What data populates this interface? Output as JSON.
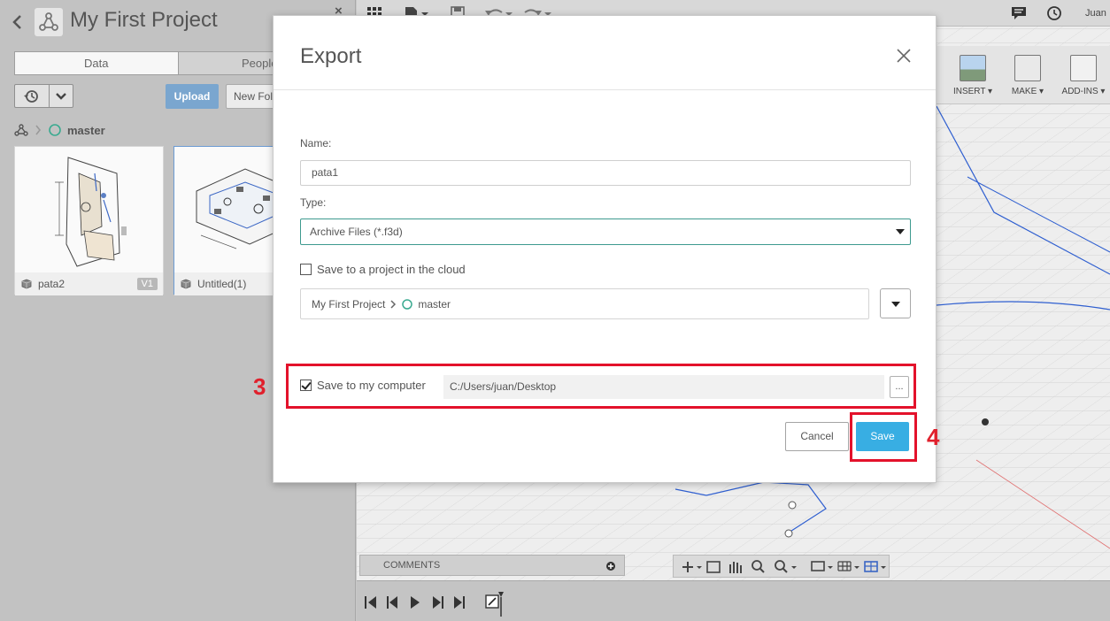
{
  "left_panel": {
    "project_title": "My First Project",
    "close_glyph": "×",
    "tabs": [
      {
        "label": "Data",
        "active": true
      },
      {
        "label": "People",
        "active": false
      }
    ],
    "upload_label": "Upload",
    "new_folder_label": "New Folder",
    "breadcrumb_branch": "master",
    "files": [
      {
        "name": "pata2",
        "version": "V1"
      },
      {
        "name": "Untitled(1)"
      }
    ]
  },
  "ribbon": {
    "items": [
      {
        "label": "INSERT ▾",
        "icon": "image-icon"
      },
      {
        "label": "MAKE ▾",
        "icon": "printer-icon"
      },
      {
        "label": "ADD-INS ▾",
        "icon": "script-gear-icon"
      }
    ]
  },
  "top_bar": {
    "user": "Juan"
  },
  "comments": {
    "label": "COMMENTS"
  },
  "dialog": {
    "title": "Export",
    "name_label": "Name:",
    "name_value": "pata1",
    "type_label": "Type:",
    "type_value": "Archive Files (*.f3d)",
    "cloud_label": "Save to a project in the cloud",
    "cloud_checked": false,
    "location_project": "My First Project",
    "location_branch": "master",
    "computer_label": "Save to my computer",
    "computer_checked": true,
    "computer_path": "C:/Users/juan/Desktop",
    "browse_label": "...",
    "cancel_label": "Cancel",
    "save_label": "Save"
  },
  "annotations": {
    "step_3": "3",
    "step_4": "4"
  },
  "colors": {
    "accent": "#38aee3",
    "highlight": "#e3122b",
    "select_border": "#3e9a8f",
    "branch_circle": "#3aaa90"
  }
}
